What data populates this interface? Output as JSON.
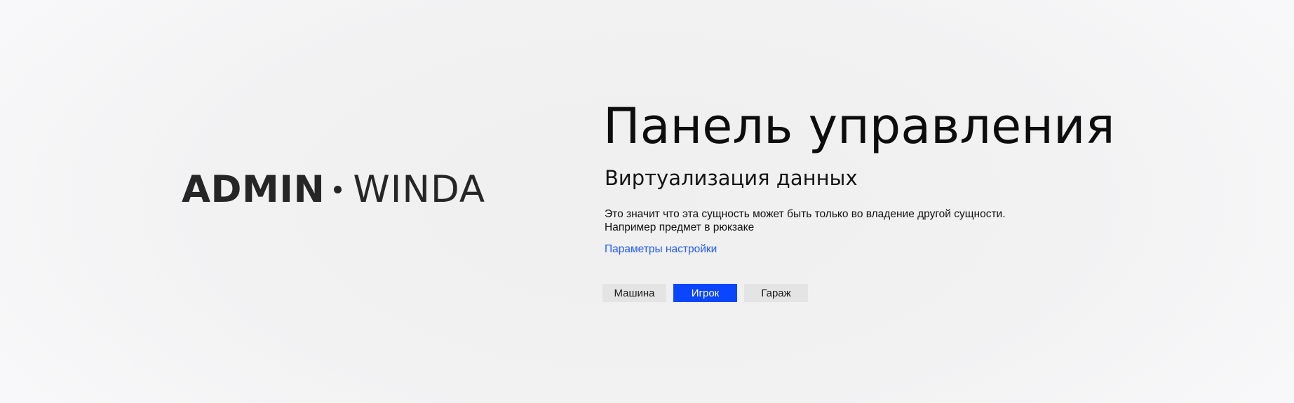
{
  "logo": {
    "primary": "ADMIN",
    "secondary": "WINDA"
  },
  "main": {
    "title": "Панель управления",
    "subtitle": "Виртуализация данных",
    "description_lines": [
      "Это значит что эта сущность может быть только во владение другой сущности.",
      "Например предмет в рюкзаке"
    ],
    "settings_link": "Параметры настройки"
  },
  "tabs": [
    {
      "label": "Машина",
      "active": false
    },
    {
      "label": "Игрок",
      "active": true
    },
    {
      "label": "Гараж",
      "active": false
    }
  ],
  "colors": {
    "accent": "#0a46ff",
    "link": "#1f5bff",
    "tab_inactive": "#e4e4e4"
  }
}
